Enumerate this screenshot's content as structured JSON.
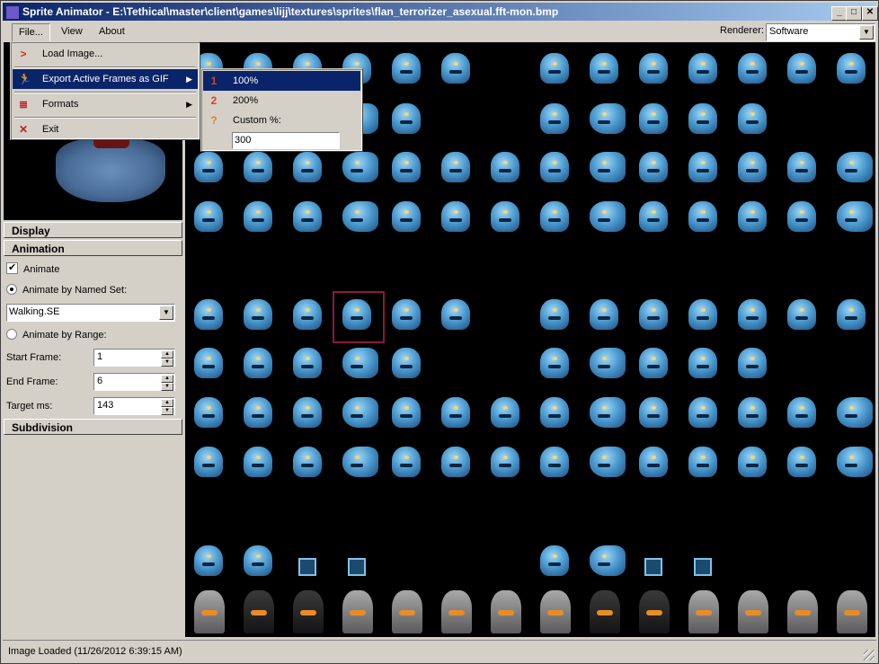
{
  "window": {
    "title": "Sprite Animator - E:\\Tethical\\master\\client\\games\\lijj\\textures\\sprites\\flan_terrorizer_asexual.fft-mon.bmp",
    "minimize": "_",
    "maximize": "□",
    "close": "✕"
  },
  "menubar": {
    "file": "File...",
    "view": "View",
    "about": "About",
    "renderer_label": "Renderer:",
    "renderer_value": "Software"
  },
  "file_menu": {
    "items": [
      {
        "label": "Load Image...",
        "icon": "load-icon"
      },
      {
        "label": "Export Active Frames as GIF",
        "icon": "export-gif-icon"
      },
      {
        "label": "Formats",
        "icon": "formats-icon"
      },
      {
        "label": "Exit",
        "icon": "exit-icon"
      }
    ]
  },
  "export_submenu": {
    "items": [
      {
        "label": "100%",
        "icon": "1"
      },
      {
        "label": "200%",
        "icon": "2"
      },
      {
        "label": "Custom %:",
        "icon": "?"
      }
    ],
    "custom_value": "300"
  },
  "panel": {
    "display_header": "Display",
    "animation_header": "Animation",
    "animate_label": "Animate",
    "named_set_label": "Animate by Named Set:",
    "named_set_value": "Walking.SE",
    "range_label": "Animate by Range:",
    "start_label": "Start Frame:",
    "start_value": "1",
    "end_label": "End Frame:",
    "end_value": "6",
    "target_label": "Target ms:",
    "target_value": "143",
    "subdivision_header": "Subdivision"
  },
  "status": {
    "text": "Image Loaded (11/26/2012 6:39:15 AM)"
  }
}
